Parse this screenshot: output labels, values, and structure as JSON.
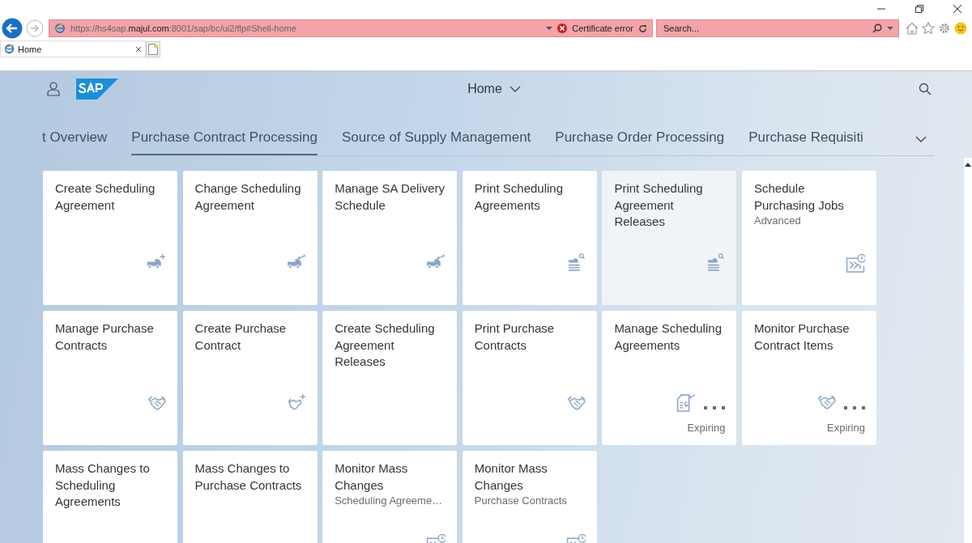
{
  "browser": {
    "address": "https://hs4sap.**majul.com**:8001/sap/bc/ui2/flp#Shell-home",
    "certificate": "Certificate error",
    "search_placeholder": "Search...",
    "tabs": [
      {
        "label": "Home",
        "selected": true
      }
    ]
  },
  "shell": {
    "title": "Home"
  },
  "groups": [
    {
      "label": "t Overview",
      "selected": false
    },
    {
      "label": "Purchase Contract Processing",
      "selected": true
    },
    {
      "label": "Source of Supply Management",
      "selected": false
    },
    {
      "label": "Purchase Order Processing",
      "selected": false
    },
    {
      "label": "Purchase Requisiti",
      "selected": false
    }
  ],
  "tiles": [
    {
      "title": "Create Scheduling Agreement",
      "kind": "truck-plus",
      "hovered": false,
      "more": false
    },
    {
      "title": "Change Scheduling Agreement",
      "kind": "truck-arrows",
      "hovered": false,
      "more": false
    },
    {
      "title": "Manage SA Delivery Schedule",
      "kind": "truck-arrows",
      "hovered": false,
      "more": false
    },
    {
      "title": "Print Scheduling Agreements",
      "kind": "truck-search",
      "hovered": false,
      "more": false
    },
    {
      "title": "Print Scheduling Agreement Releases",
      "kind": "truck-search",
      "hovered": true,
      "more": false
    },
    {
      "title": "Schedule Purchasing Jobs",
      "subtitle": "Advanced",
      "kind": "jobs",
      "hovered": false,
      "more": false
    },
    {
      "title": "Manage Purchase Contracts",
      "kind": "handshake",
      "hovered": false,
      "more": false
    },
    {
      "title": "Create Purchase Contract",
      "kind": "handshake-plus",
      "hovered": false,
      "more": false
    },
    {
      "title": "Create Scheduling Agreement Releases",
      "hovered": false,
      "more": false
    },
    {
      "title": "Print Purchase Contracts",
      "kind": "handshake",
      "hovered": false,
      "more": false
    },
    {
      "title": "Manage Scheduling Agreements",
      "footer": "Expiring",
      "kind": "document",
      "hovered": false,
      "more": true
    },
    {
      "title": "Monitor Purchase Contract Items",
      "footer": "Expiring",
      "kind": "handshake",
      "hovered": false,
      "more": true
    },
    {
      "title": "Mass Changes to Scheduling Agreements",
      "hovered": false,
      "more": false
    },
    {
      "title": "Mass Changes to Purchase Contracts",
      "hovered": false,
      "more": false
    },
    {
      "title": "Monitor Mass Changes",
      "subtitle": "Scheduling Agreeme…",
      "kind": "jobs",
      "hovered": false,
      "more": false
    },
    {
      "title": "Monitor Mass Changes",
      "subtitle": "Purchase Contracts",
      "kind": "jobs",
      "hovered": false,
      "more": false
    }
  ]
}
